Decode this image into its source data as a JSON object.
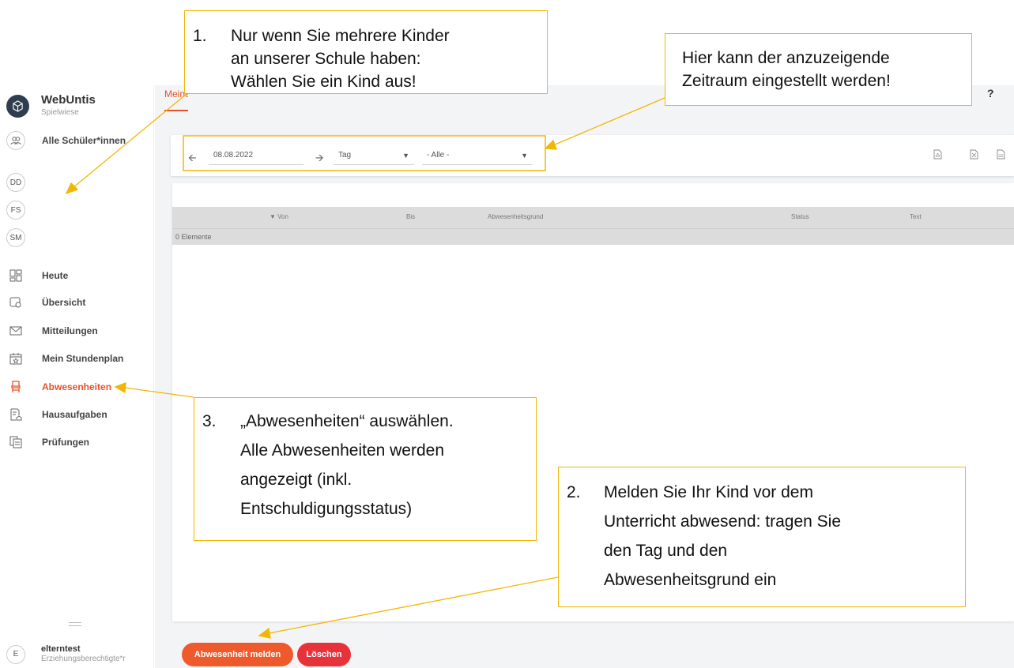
{
  "app": {
    "brand_title": "WebUntis",
    "brand_subtitle": "Spielwiese",
    "help": "?",
    "active_tab_label": "Meine Abwesenheiten"
  },
  "students": {
    "all_label": "Alle Schüler*innen",
    "initials": [
      "DD",
      "FS",
      "SM"
    ]
  },
  "nav": {
    "items": [
      {
        "label": "Heute",
        "icon": "dashboard-icon"
      },
      {
        "label": "Übersicht",
        "icon": "overview-icon"
      },
      {
        "label": "Mitteilungen",
        "icon": "envelope-icon"
      },
      {
        "label": "Mein Stundenplan",
        "icon": "calendar-icon"
      },
      {
        "label": "Abwesenheiten",
        "icon": "chair-icon"
      },
      {
        "label": "Hausaufgaben",
        "icon": "homework-icon"
      },
      {
        "label": "Prüfungen",
        "icon": "exams-icon"
      }
    ]
  },
  "user": {
    "initial": "E",
    "name": "elterntest",
    "role": "Erziehungsberechtigte*r"
  },
  "filter": {
    "date": "08.08.2022",
    "period": "Tag",
    "selection": "- Alle -"
  },
  "table": {
    "columns": {
      "von": "Von",
      "bis": "Bis",
      "grund": "Abwesenheitsgrund",
      "status": "Status",
      "text": "Text"
    },
    "count": "0 Elemente"
  },
  "buttons": {
    "report": "Abwesenheit melden",
    "delete": "Löschen"
  },
  "callouts": {
    "c1": {
      "num": "1.",
      "lines": [
        "Nur wenn Sie mehrere Kinder",
        "an unserer Schule haben:",
        "Wählen Sie ein Kind aus!"
      ]
    },
    "c_period": {
      "lines": [
        "Hier kann der anzuzeigende",
        "Zeitraum eingestellt werden!"
      ]
    },
    "c3": {
      "num": "3.",
      "lines": [
        "„Abwesenheiten“ auswählen.",
        "Alle Abwesenheiten werden",
        "angezeigt (inkl.",
        "Entschuldigungsstatus)"
      ]
    },
    "c2": {
      "num": "2.",
      "lines": [
        "Melden Sie Ihr Kind vor dem",
        "Unterricht abwesend: tragen Sie",
        "den Tag und den",
        "Abwesenheitsgrund ein"
      ]
    }
  },
  "colors": {
    "accent": "#e8512d",
    "callout_border": "#f2b705",
    "delete": "#e8323a"
  }
}
